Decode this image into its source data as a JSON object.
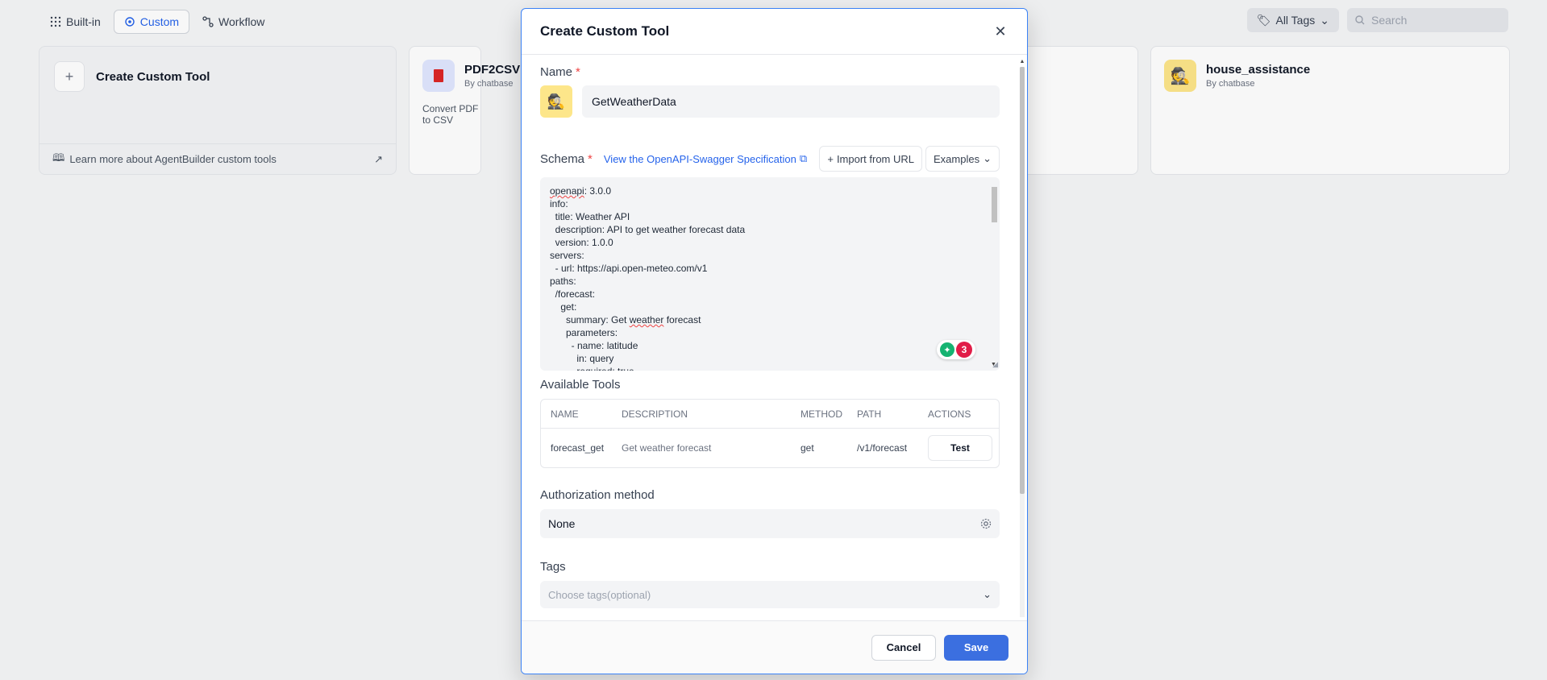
{
  "nav": {
    "tabs": [
      {
        "label": "Built-in"
      },
      {
        "label": "Custom"
      },
      {
        "label": "Workflow"
      }
    ],
    "tags_label": "All Tags",
    "search_placeholder": "Search"
  },
  "cards": {
    "create": {
      "title": "Create Custom Tool",
      "learn_more": "Learn more about AgentBuilder custom tools"
    },
    "pdf": {
      "name": "PDF2CSV",
      "by": "By chatbase",
      "desc": "Convert PDF to CSV"
    },
    "house": {
      "name": "house_assistance",
      "by": "By chatbase"
    }
  },
  "modal": {
    "title": "Create Custom Tool",
    "name_label": "Name",
    "name_value": "GetWeatherData",
    "schema_label": "Schema",
    "spec_link": "View the OpenAPI-Swagger Specification",
    "import_label": "Import from URL",
    "examples_label": "Examples",
    "grammarly_count": "3",
    "available_tools_label": "Available Tools",
    "table": {
      "headers": [
        "NAME",
        "DESCRIPTION",
        "METHOD",
        "PATH",
        "ACTIONS"
      ],
      "rows": [
        {
          "name": "forecast_get",
          "description": "Get weather forecast",
          "method": "get",
          "path": "/v1/forecast",
          "action": "Test"
        }
      ]
    },
    "auth_label": "Authorization method",
    "auth_value": "None",
    "tags_label": "Tags",
    "tags_placeholder": "Choose tags(optional)",
    "cancel_label": "Cancel",
    "save_label": "Save"
  },
  "schema_lines": [
    "openapi: 3.0.0",
    "info:",
    "  title: Weather API",
    "  description: API to get weather forecast data",
    "  version: 1.0.0",
    "servers:",
    "  - url: https://api.open-meteo.com/v1",
    "paths:",
    "  /forecast:",
    "    get:",
    "      summary: Get weather forecast",
    "      parameters:",
    "        - name: latitude",
    "          in: query",
    "          required: true"
  ],
  "colors": {
    "accent": "#2563eb",
    "save": "#3b6fe0",
    "required": "#ef4444"
  }
}
